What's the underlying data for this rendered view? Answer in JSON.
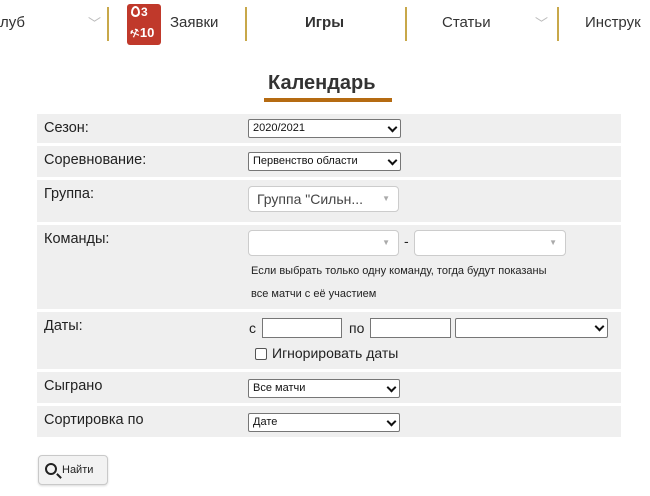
{
  "nav": {
    "items": [
      {
        "label": "луб"
      },
      {
        "label": "Заявки"
      },
      {
        "label": "Игры"
      },
      {
        "label": "Статьи"
      },
      {
        "label": "Инструк"
      }
    ],
    "badge": {
      "top": "3",
      "bottom": "10"
    }
  },
  "page": {
    "title": "Календарь"
  },
  "form": {
    "season": {
      "label": "Сезон:",
      "value": "2020/2021"
    },
    "competition": {
      "label": "Соревнование:",
      "value": "Первенство области"
    },
    "group": {
      "label": "Группа:",
      "value": "Группа \"Сильн..."
    },
    "teams": {
      "label": "Команды:",
      "separator": "-",
      "hint_line1": "Если выбрать только одну команду, тогда будут показаны",
      "hint_line2": "все матчи с её участием"
    },
    "dates": {
      "label": "Даты:",
      "from_label": "с",
      "to_label": "по",
      "ignore_label": "Игнорировать даты"
    },
    "played": {
      "label": "Сыграно",
      "value": "Все матчи"
    },
    "sort": {
      "label": "Сортировка по",
      "value": "Дате"
    },
    "search_button": "Найти"
  },
  "colors": {
    "accent": "#b56b12",
    "nav_separator": "#c8a84a",
    "badge": "#c0392b",
    "row_bg": "#efefef"
  }
}
